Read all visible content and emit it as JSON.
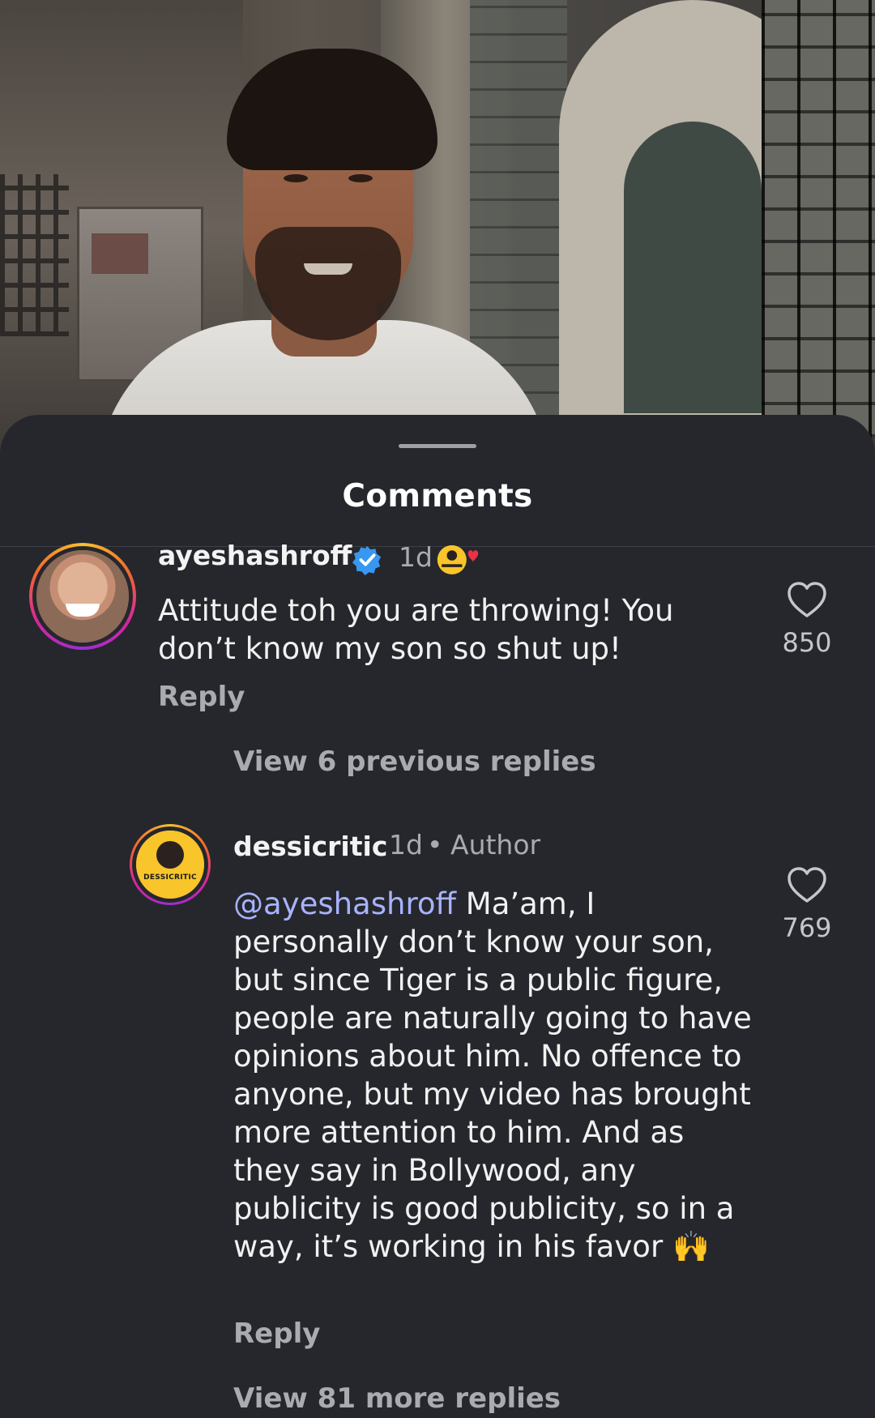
{
  "sheet": {
    "title": "Comments"
  },
  "comments": [
    {
      "username": "ayeshashroff",
      "verified": true,
      "time": "1d",
      "text": "Attitude toh you are throwing! You don’t know my son so shut up!",
      "reply_label": "Reply",
      "likes": "850",
      "avatar_icon": "profile-photo"
    },
    {
      "username": "dessicritic",
      "time": "1d",
      "separator": "•",
      "badge": "Author",
      "mention": "@ayeshashroff",
      "text": "Ma’am, I personally don’t know your son, but since Tiger is a public figure, people are naturally going to have opinions about him. No offence to anyone, but my video has brought more attention to him. And as they say in Bollywood, any publicity is good publicity, so in a way, it’s working in his favor",
      "emoji": "🙌",
      "reply_label": "Reply",
      "likes": "769",
      "avatar_label": "DESSICRITIC"
    }
  ],
  "view_previous": "View 6 previous replies",
  "view_more": "View 81 more replies",
  "colors": {
    "sheet_bg": "#25272c",
    "mention": "#a8b3ff",
    "verified": "#3897f0",
    "liked_heart": "#ed2f48"
  }
}
